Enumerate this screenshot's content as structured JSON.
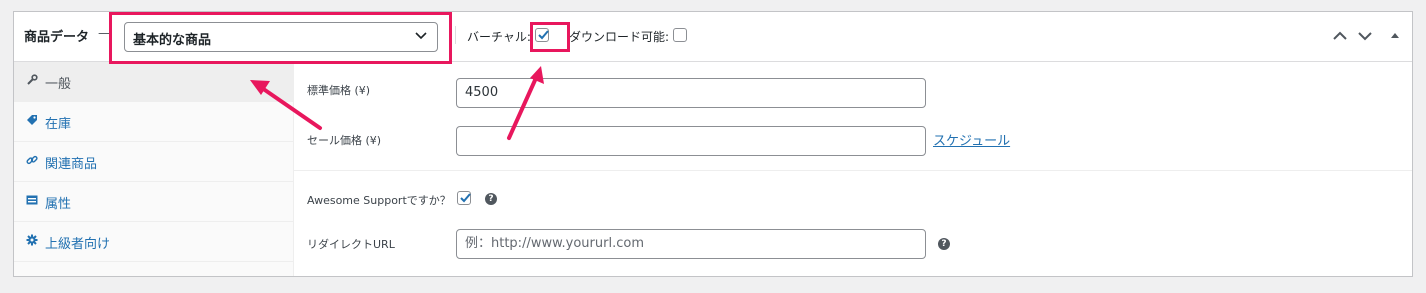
{
  "panel": {
    "title": "商品データ",
    "title_dash": "—",
    "product_type_select": {
      "value": "基本的な商品"
    },
    "options": {
      "virtual_label": "バーチャル:",
      "virtual_checked": true,
      "downloadable_label": "ダウンロード可能:",
      "downloadable_checked": false
    },
    "header_buttons": [
      "chevron-up-icon",
      "chevron-down-icon",
      "triangle-up-icon"
    ]
  },
  "sidebar": {
    "items": [
      {
        "label": "一般",
        "icon": "wrench-icon",
        "active": true
      },
      {
        "label": "在庫",
        "icon": "tag-icon",
        "active": false
      },
      {
        "label": "関連商品",
        "icon": "link-icon",
        "active": false
      },
      {
        "label": "属性",
        "icon": "table-icon",
        "active": false
      },
      {
        "label": "上級者向け",
        "icon": "gear-icon",
        "active": false
      }
    ]
  },
  "general": {
    "regular_price_label": "標準価格 (¥)",
    "regular_price_value": "4500",
    "sale_price_label": "セール価格 (¥)",
    "sale_price_value": "",
    "schedule_link": "スケジュール",
    "awesome_support_label": "Awesome Supportですか？",
    "awesome_support_checked": true,
    "redirect_url_label": "リダイレクトURL",
    "redirect_url_placeholder": "例：http://www.yoururl.com"
  },
  "colors": {
    "highlight": "#e8175d",
    "link": "#2271b1",
    "checkbox_check": "#2271b1"
  }
}
